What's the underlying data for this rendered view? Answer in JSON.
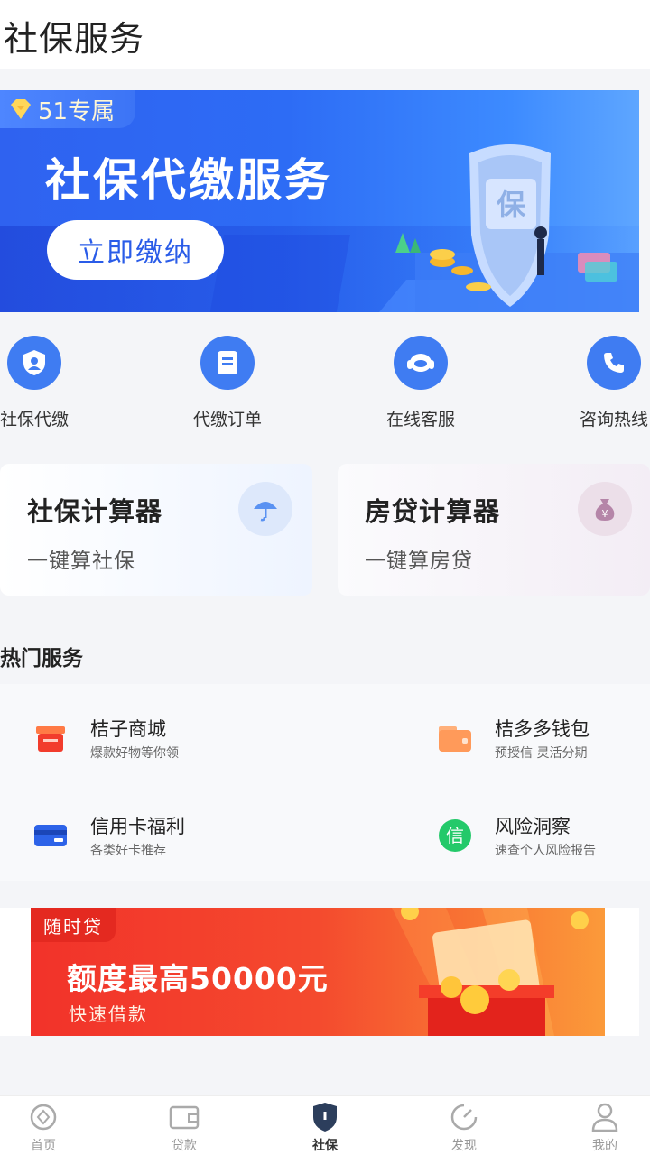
{
  "header": {
    "title": "社保服务"
  },
  "banner": {
    "badge": "51专属",
    "title": "社保代缴服务",
    "button": "立即缴纳",
    "shield_text": "保"
  },
  "quick_actions": [
    {
      "label": "社保代缴",
      "icon": "person-shield-icon"
    },
    {
      "label": "代缴订单",
      "icon": "document-icon"
    },
    {
      "label": "在线客服",
      "icon": "headset-icon"
    },
    {
      "label": "咨询热线",
      "icon": "phone-icon"
    }
  ],
  "calculators": [
    {
      "title": "社保计算器",
      "subtitle": "一键算社保",
      "icon": "umbrella-icon"
    },
    {
      "title": "房贷计算器",
      "subtitle": "一键算房贷",
      "icon": "money-bag-icon"
    }
  ],
  "hot_services": {
    "title": "热门服务",
    "items": [
      {
        "title": "桔子商城",
        "subtitle": "爆款好物等你领",
        "icon": "shop-icon"
      },
      {
        "title": "桔多多钱包",
        "subtitle": "预授信 灵活分期",
        "icon": "wallet-icon"
      },
      {
        "title": "信用卡福利",
        "subtitle": "各类好卡推荐",
        "icon": "credit-card-icon"
      },
      {
        "title": "风险洞察",
        "subtitle": "速查个人风险报告",
        "icon": "credit-badge-icon",
        "icon_text": "信"
      }
    ]
  },
  "promo": {
    "tag": "随时贷",
    "title": "额度最高50000元",
    "subtitle": "快速借款"
  },
  "tabbar": {
    "items": [
      {
        "label": "首页",
        "icon": "home-icon"
      },
      {
        "label": "贷款",
        "icon": "loan-icon"
      },
      {
        "label": "社保",
        "icon": "shield-icon",
        "active": true
      },
      {
        "label": "发现",
        "icon": "discover-icon"
      },
      {
        "label": "我的",
        "icon": "profile-icon"
      }
    ]
  },
  "colors": {
    "primary": "#3f7cf2",
    "banner_blue": "#2d6cf5",
    "promo_red": "#f2322a"
  }
}
